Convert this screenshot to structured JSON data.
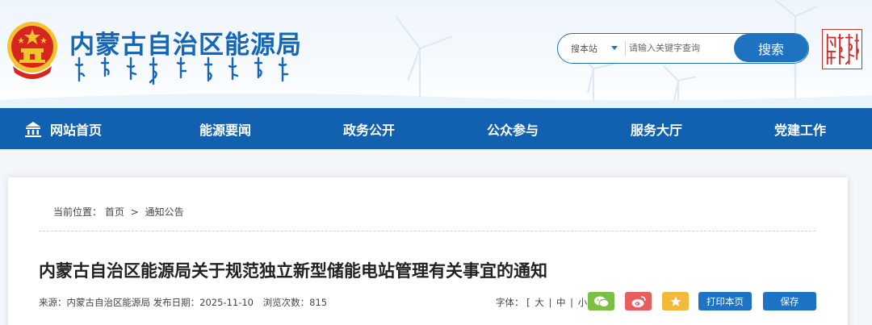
{
  "header": {
    "site_title": "内蒙古自治区能源局",
    "search": {
      "scope_label": "搜本站",
      "placeholder": "请输入关键字查询",
      "button_label": "搜索"
    }
  },
  "nav": {
    "items": [
      {
        "label": "网站首页",
        "icon": "home-icon"
      },
      {
        "label": "能源要闻"
      },
      {
        "label": "政务公开"
      },
      {
        "label": "公众参与"
      },
      {
        "label": "服务大厅"
      },
      {
        "label": "党建工作"
      }
    ]
  },
  "breadcrumb": {
    "prefix": "当前位置：",
    "items": [
      "首页",
      "通知公告"
    ],
    "separator": ">"
  },
  "article": {
    "title": "内蒙古自治区能源局关于规范独立新型储能电站管理有关事宜的通知",
    "meta": {
      "source_label": "来源：",
      "source": "内蒙古自治区能源局",
      "date_label": "发布日期：",
      "date": "2025-11-10",
      "views_label": "浏览次数：",
      "views": "815"
    },
    "font_size": {
      "label": "字体：",
      "open": "[",
      "large": "大",
      "medium": "中",
      "small": "小",
      "close": "]",
      "sep": "|"
    },
    "share": [
      {
        "name": "wechat-icon",
        "color": "#7ac143"
      },
      {
        "name": "weibo-icon",
        "color": "#e85d5d"
      },
      {
        "name": "favorite-star-icon",
        "color": "#f2b93b"
      }
    ],
    "actions": {
      "print_label": "打印本页",
      "save_label": "保存"
    }
  },
  "colors": {
    "brand_blue": "#1161b0",
    "title_blue": "#1666b8",
    "button_blue": "#1e73c5",
    "seal_red": "#d02d2d"
  }
}
